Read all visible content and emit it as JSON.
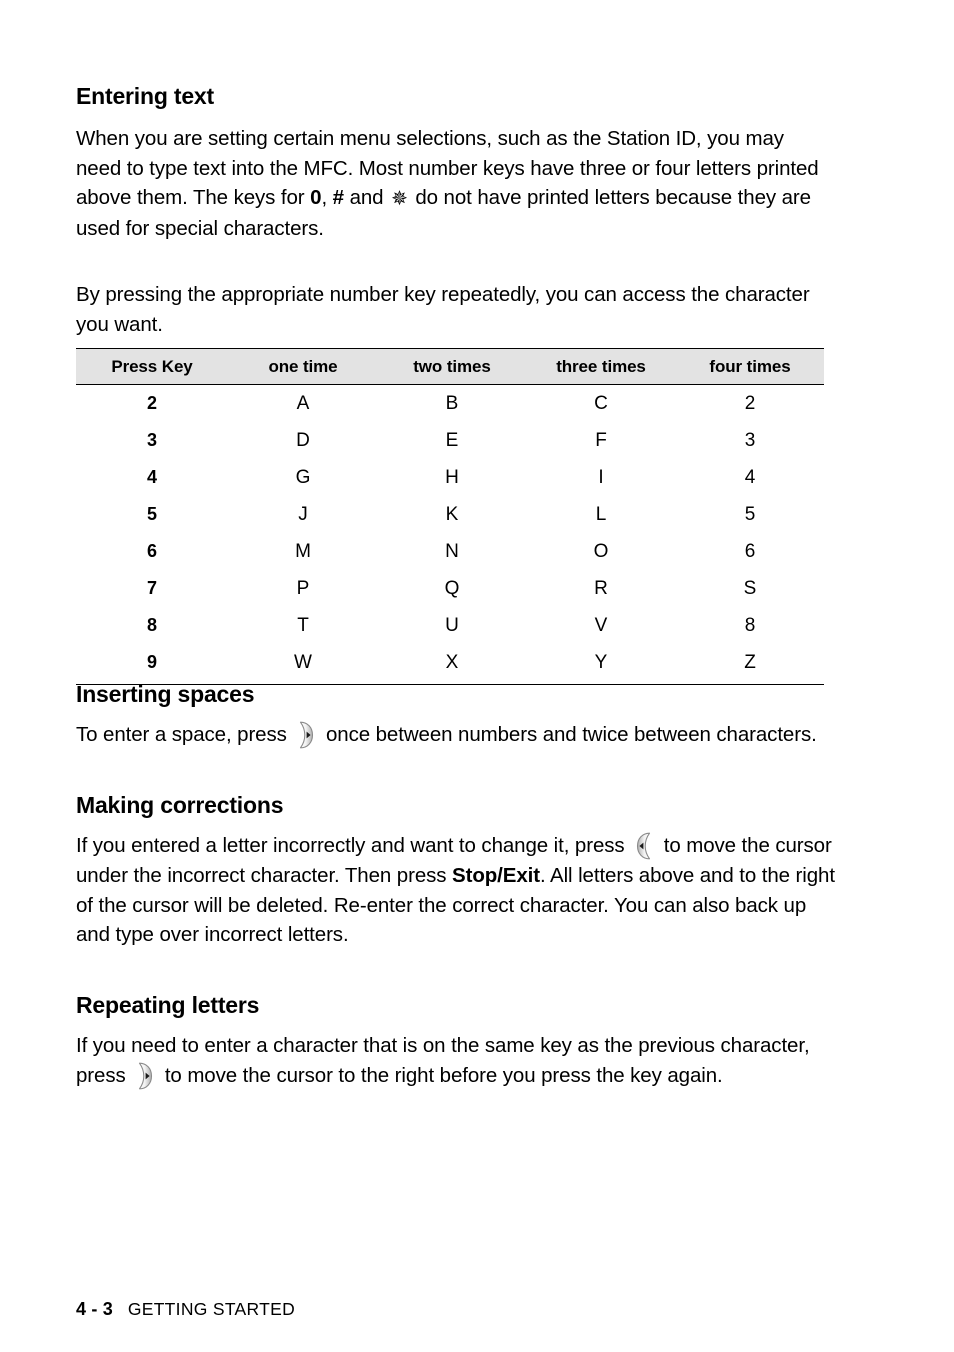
{
  "document": {
    "sections": [
      {
        "id": "entering-text",
        "heading": "Entering text",
        "paragraphs": [
          {
            "id": "entering-text-p1",
            "runs": [
              {
                "text": "When you are setting certain menu selections, such as the Station ID, you may need to type text into the MFC. Most number keys have three or four letters printed above them. The keys for ",
                "style": "normal"
              },
              {
                "text": "0",
                "style": "bold"
              },
              {
                "text": ", ",
                "style": "normal"
              },
              {
                "text": "#",
                "style": "bold"
              },
              {
                "text": " and ",
                "style": "normal"
              },
              {
                "text": "✵",
                "style": "star"
              },
              {
                "text": " do not have printed letters because they are used for special characters.",
                "style": "normal"
              }
            ]
          },
          {
            "id": "entering-text-p2",
            "runs": [
              {
                "text": "By pressing the appropriate number key repeatedly, you can access the character you want.",
                "style": "normal"
              }
            ]
          }
        ]
      },
      {
        "id": "inserting-spaces",
        "heading": "Inserting spaces",
        "paragraphs": [
          {
            "id": "inserting-spaces-p1",
            "runs": [
              {
                "text": "To enter a space, press ",
                "style": "normal"
              },
              {
                "text": "",
                "style": "icon",
                "icon": "right-arrow-key-icon"
              },
              {
                "text": " once between numbers and twice between characters.",
                "style": "normal"
              }
            ]
          }
        ]
      },
      {
        "id": "making-corrections",
        "heading": "Making corrections",
        "paragraphs": [
          {
            "id": "making-corrections-p1",
            "runs": [
              {
                "text": "If you entered a letter incorrectly and want to change it, press ",
                "style": "normal"
              },
              {
                "text": "",
                "style": "icon",
                "icon": "left-arrow-key-icon"
              },
              {
                "text": " to move the cursor under the incorrect character. Then press ",
                "style": "normal"
              },
              {
                "text": "Stop/Exit",
                "style": "bold"
              },
              {
                "text": ". All letters above and to the right of the cursor will be deleted. Re-enter the correct character. You can also back up and type over incorrect letters.",
                "style": "normal"
              }
            ]
          }
        ]
      },
      {
        "id": "repeating-letters",
        "heading": "Repeating letters",
        "paragraphs": [
          {
            "id": "repeating-letters-p1",
            "runs": [
              {
                "text": "If you need to enter a character that is on the same key as the previous character, press ",
                "style": "normal"
              },
              {
                "text": "",
                "style": "icon",
                "icon": "right-arrow-key-icon"
              },
              {
                "text": " to move the cursor to the right before you press the key again.",
                "style": "normal"
              }
            ]
          }
        ]
      }
    ]
  },
  "table": {
    "headers": [
      "Press Key",
      "one time",
      "two times",
      "three times",
      "four times"
    ],
    "rows": [
      [
        "2",
        "A",
        "B",
        "C",
        "2"
      ],
      [
        "3",
        "D",
        "E",
        "F",
        "3"
      ],
      [
        "4",
        "G",
        "H",
        "I",
        "4"
      ],
      [
        "5",
        "J",
        "K",
        "L",
        "5"
      ],
      [
        "6",
        "M",
        "N",
        "O",
        "6"
      ],
      [
        "7",
        "P",
        "Q",
        "R",
        "S"
      ],
      [
        "8",
        "T",
        "U",
        "V",
        "8"
      ],
      [
        "9",
        "W",
        "X",
        "Y",
        "Z"
      ]
    ]
  },
  "footer": {
    "page_number": "4 - 3",
    "chapter": "GETTING STARTED"
  },
  "colors": {
    "text": "#000000",
    "page_background": "#ffffff",
    "table_header_background": "#e3e3e3",
    "table_rule": "#000000",
    "key_icon_body_light": "#fdfdfd",
    "key_icon_body_shade": "#b9b9b9",
    "key_icon_outline": "#8a8a8a",
    "key_icon_arrow": "#1a1a1a"
  }
}
